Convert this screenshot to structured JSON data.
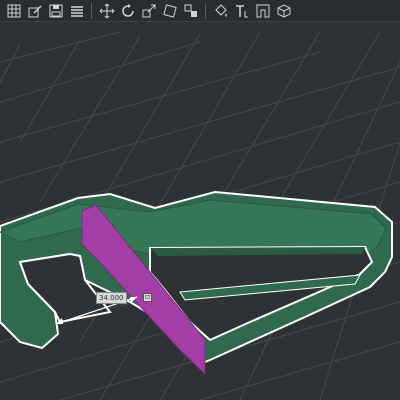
{
  "toolbar": {
    "groups": [
      [
        "grid-icon",
        "sketch-icon",
        "save-icon",
        "layers-icon"
      ],
      [
        "move-icon",
        "rotate-icon",
        "scale-icon",
        "mirror-icon",
        "align-icon"
      ],
      [
        "paint-bucket-icon",
        "text-icon",
        "frame-icon",
        "box-icon"
      ]
    ]
  },
  "viewport": {
    "dimension_value": "34.000",
    "colors": {
      "background": "#2f3235",
      "grid_line": "#45494d",
      "body_fill": "#2f6a4c",
      "selected_face": "#a33ea6",
      "outline": "#ffffff"
    }
  }
}
